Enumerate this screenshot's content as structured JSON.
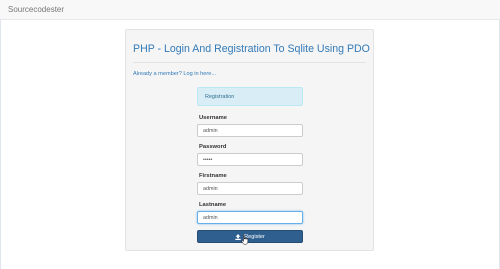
{
  "navbar": {
    "brand": "Sourcecodester"
  },
  "panel": {
    "title": "PHP - Login And Registration To Sqlite Using PDO",
    "member_link": "Already a member? Log in here..."
  },
  "form": {
    "alert": "Registration",
    "fields": [
      {
        "label": "Username",
        "value": "admin"
      },
      {
        "label": "Password",
        "value": "admin"
      },
      {
        "label": "Firstname",
        "value": "admin"
      },
      {
        "label": "Lastname",
        "value": "admin"
      }
    ],
    "submit_label": "Register"
  },
  "colors": {
    "link": "#337ab7",
    "button": "#2f5f8f",
    "alert_bg": "#d9edf7",
    "alert_text": "#31708f"
  },
  "icons": {
    "submit": "upload-icon",
    "pointer": "hand-cursor-icon"
  }
}
